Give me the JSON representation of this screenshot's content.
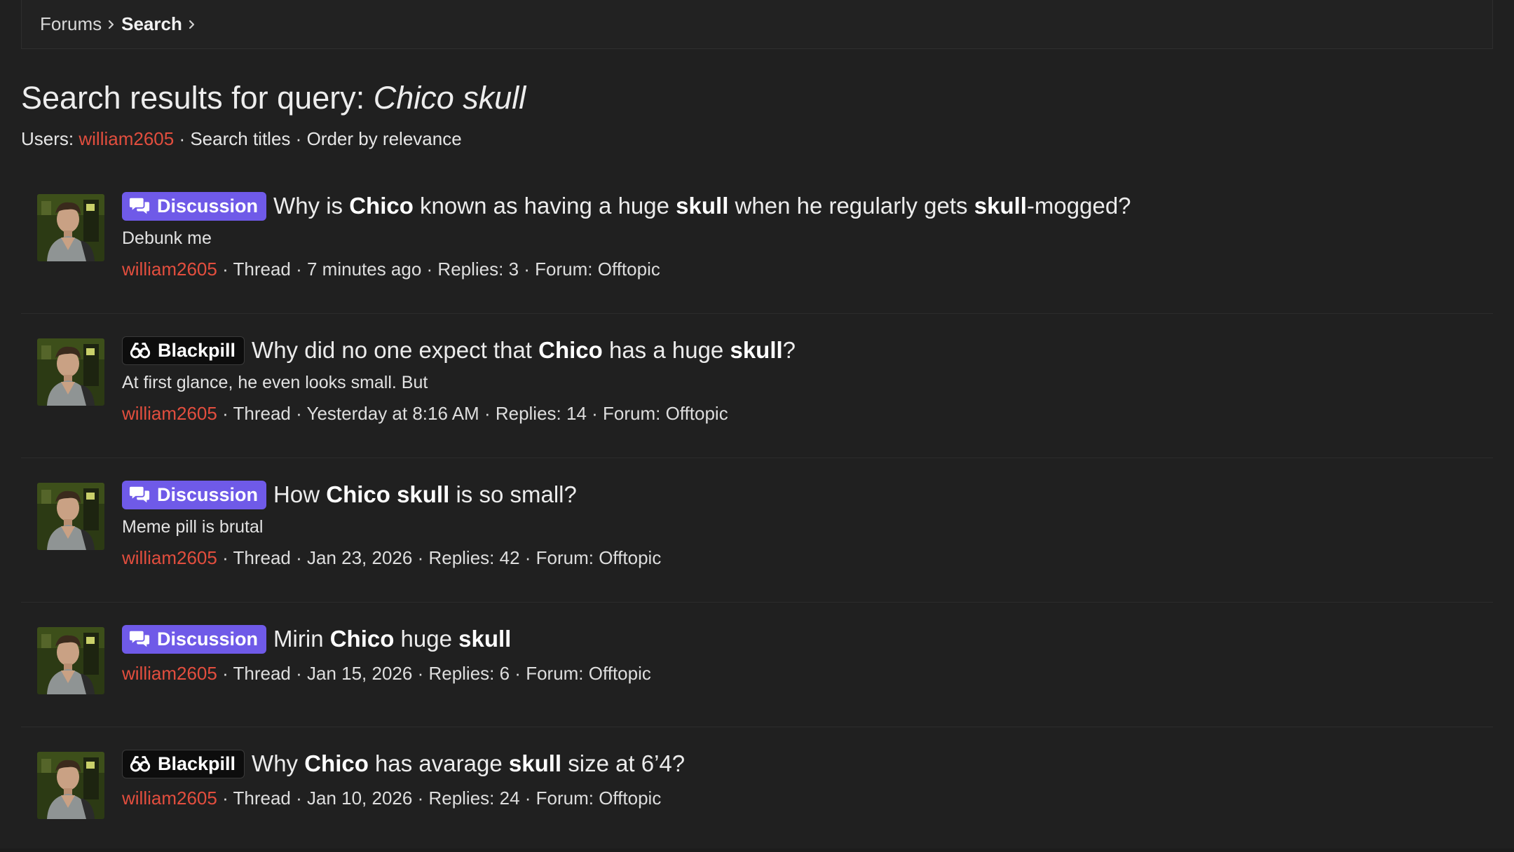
{
  "breadcrumb": {
    "items": [
      "Forums",
      "Search"
    ]
  },
  "heading": {
    "prefix": "Search results for query: ",
    "query": "Chico skull"
  },
  "filters": {
    "users_label": "Users:",
    "user": "william2605",
    "search_titles": "Search titles",
    "order": "Order by relevance",
    "separator": "·"
  },
  "colors": {
    "accent": "#e24e3e",
    "discussion": "#6f5ae8",
    "blackpill": "#0d0d0d"
  },
  "results": [
    {
      "prefix": "Discussion",
      "prefix_icon": "chat-bubbles-icon",
      "title": [
        "Why is ",
        "Chico",
        " known as having a huge ",
        "skull",
        " when he regularly gets ",
        "skull",
        "-mogged?"
      ],
      "snippet": "Debunk me",
      "author": "william2605",
      "type": "Thread",
      "date": "7 minutes ago",
      "replies": "Replies: 3",
      "forum": "Forum: Offtopic"
    },
    {
      "prefix": "Blackpill",
      "prefix_icon": "glasses-icon",
      "title": [
        "Why did no one expect that ",
        "Chico",
        " has a huge ",
        "skull",
        "?"
      ],
      "snippet": "At first glance, he even looks small. But",
      "author": "william2605",
      "type": "Thread",
      "date": "Yesterday at 8:16 AM",
      "replies": "Replies: 14",
      "forum": "Forum: Offtopic"
    },
    {
      "prefix": "Discussion",
      "prefix_icon": "chat-bubbles-icon",
      "title": [
        "How ",
        "Chico skull",
        " is so small?"
      ],
      "snippet": "Meme pill is brutal",
      "author": "william2605",
      "type": "Thread",
      "date": "Jan 23, 2026",
      "replies": "Replies: 42",
      "forum": "Forum: Offtopic"
    },
    {
      "prefix": "Discussion",
      "prefix_icon": "chat-bubbles-icon",
      "title": [
        "Mirin ",
        "Chico",
        " huge ",
        "skull"
      ],
      "snippet": "",
      "author": "william2605",
      "type": "Thread",
      "date": "Jan 15, 2026",
      "replies": "Replies: 6",
      "forum": "Forum: Offtopic"
    },
    {
      "prefix": "Blackpill",
      "prefix_icon": "glasses-icon",
      "title": [
        "Why ",
        "Chico",
        " has avarage ",
        "skull",
        " size at 6’4?"
      ],
      "snippet": "",
      "author": "william2605",
      "type": "Thread",
      "date": "Jan 10, 2026",
      "replies": "Replies: 24",
      "forum": "Forum: Offtopic"
    }
  ]
}
